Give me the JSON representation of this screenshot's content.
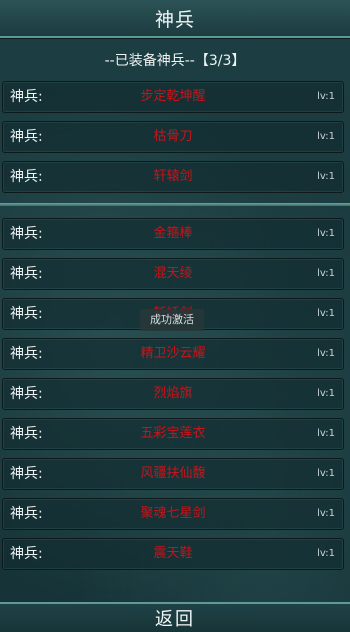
{
  "header": {
    "title": "神兵"
  },
  "equipped": {
    "header_text": "--已装备神兵--【3/3】",
    "items": [
      {
        "label": "神兵:",
        "name": "步定乾坤醒",
        "level": "lv:1"
      },
      {
        "label": "神兵:",
        "name": "枯骨刀",
        "level": "lv:1"
      },
      {
        "label": "神兵:",
        "name": "轩辕剑",
        "level": "lv:1"
      }
    ]
  },
  "inventory": {
    "items": [
      {
        "label": "神兵:",
        "name": "金箍棒",
        "level": "lv:1"
      },
      {
        "label": "神兵:",
        "name": "混天绫",
        "level": "lv:1"
      },
      {
        "label": "神兵:",
        "name": "斩妖剑",
        "level": "lv:1"
      },
      {
        "label": "神兵:",
        "name": "精卫沙云耀",
        "level": "lv:1"
      },
      {
        "label": "神兵:",
        "name": "烈焰旗",
        "level": "lv:1"
      },
      {
        "label": "神兵:",
        "name": "五彩宝莲衣",
        "level": "lv:1"
      },
      {
        "label": "神兵:",
        "name": "风疆扶仙馥",
        "level": "lv:1"
      },
      {
        "label": "神兵:",
        "name": "聚魂七星剑",
        "level": "lv:1"
      },
      {
        "label": "神兵:",
        "name": "震天鞋",
        "level": "lv:1"
      }
    ]
  },
  "toast": {
    "text": "成功激活"
  },
  "footer": {
    "back_label": "返回"
  }
}
